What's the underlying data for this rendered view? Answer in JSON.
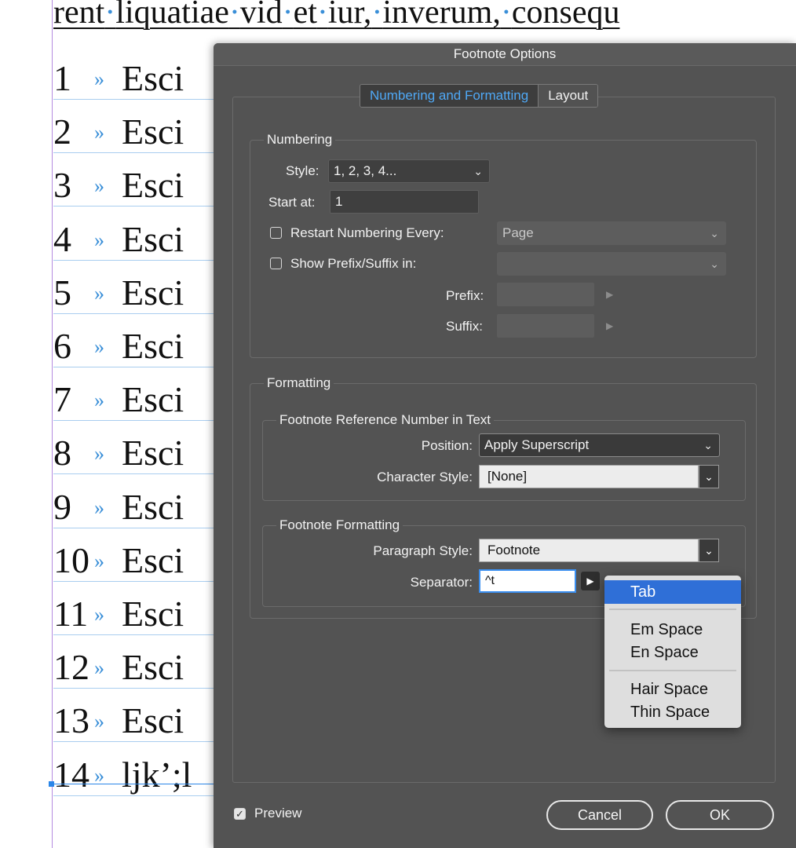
{
  "document": {
    "top_line_parts": [
      "rent",
      "liquatiae",
      "vid",
      "et",
      "iur,",
      "inverum,",
      "consequ"
    ],
    "rows": [
      {
        "num": "1",
        "text": "Esci"
      },
      {
        "num": "2",
        "text": "Esci"
      },
      {
        "num": "3",
        "text": "Esci"
      },
      {
        "num": "4",
        "text": "Esci"
      },
      {
        "num": "5",
        "text": "Esci"
      },
      {
        "num": "6",
        "text": "Esci"
      },
      {
        "num": "7",
        "text": "Esci"
      },
      {
        "num": "8",
        "text": "Esci"
      },
      {
        "num": "9",
        "text": "Esci"
      },
      {
        "num": "10",
        "text": "Esci"
      },
      {
        "num": "11",
        "text": "Esci"
      },
      {
        "num": "12",
        "text": "Esci"
      },
      {
        "num": "13",
        "text": "Esci"
      },
      {
        "num": "14",
        "text": "ljk’;l"
      }
    ],
    "marker": "»"
  },
  "dialog": {
    "title": "Footnote Options",
    "tabs": [
      {
        "label": "Numbering and Formatting",
        "active": true
      },
      {
        "label": "Layout",
        "active": false
      }
    ],
    "numbering": {
      "group_title": "Numbering",
      "style_label": "Style:",
      "style_value": "1, 2, 3, 4...",
      "start_label": "Start at:",
      "start_value": "1",
      "restart_label": "Restart Numbering Every:",
      "restart_checked": false,
      "restart_value": "Page",
      "prefix_suffix_label": "Show Prefix/Suffix in:",
      "prefix_suffix_checked": false,
      "prefix_suffix_value": "",
      "prefix_label": "Prefix:",
      "suffix_label": "Suffix:"
    },
    "formatting": {
      "group_title": "Formatting",
      "ref_group_title": "Footnote Reference Number in Text",
      "position_label": "Position:",
      "position_value": "Apply Superscript",
      "char_style_label": "Character Style:",
      "char_style_value": "[None]",
      "fn_group_title": "Footnote Formatting",
      "para_style_label": "Paragraph Style:",
      "para_style_value": "Footnote",
      "separator_label": "Separator:",
      "separator_value": "^t"
    },
    "preview_label": "Preview",
    "preview_checked": true,
    "cancel_label": "Cancel",
    "ok_label": "OK"
  },
  "separator_menu": {
    "items": [
      {
        "label": "Tab",
        "selected": true
      },
      {
        "label": "Em Space",
        "selected": false
      },
      {
        "label": "En Space",
        "selected": false
      },
      {
        "label": "Hair Space",
        "selected": false
      },
      {
        "label": "Thin Space",
        "selected": false
      }
    ]
  },
  "colors": {
    "dialog_bg": "#535353",
    "accent_blue": "#4fa8f5",
    "menu_highlight": "#2f6fd7",
    "guide_purple": "#b48be0"
  }
}
